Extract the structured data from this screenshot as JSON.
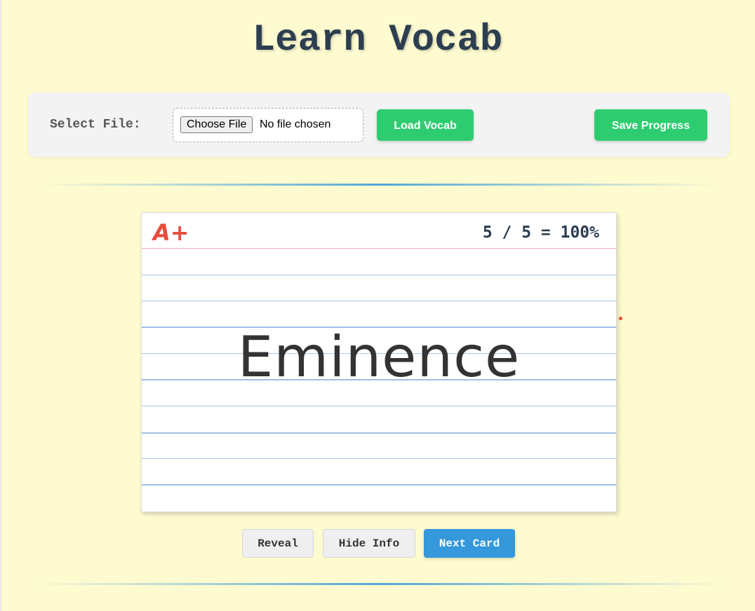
{
  "app": {
    "title": "Learn Vocab"
  },
  "controls": {
    "select_label": "Select File:",
    "choose_file_label": "Choose File",
    "file_status": "No file chosen",
    "load_label": "Load Vocab",
    "save_label": "Save Progress"
  },
  "card": {
    "grade": "A+",
    "score": "5 / 5 = 100%",
    "word": "Eminence"
  },
  "actions": {
    "reveal_label": "Reveal",
    "hide_info_label": "Hide Info",
    "next_card_label": "Next Card"
  },
  "colors": {
    "background": "#fffbd0",
    "accent_green": "#2ecc71",
    "accent_blue": "#3498db",
    "grade_red": "#e74c3c",
    "title": "#2c3e50"
  }
}
